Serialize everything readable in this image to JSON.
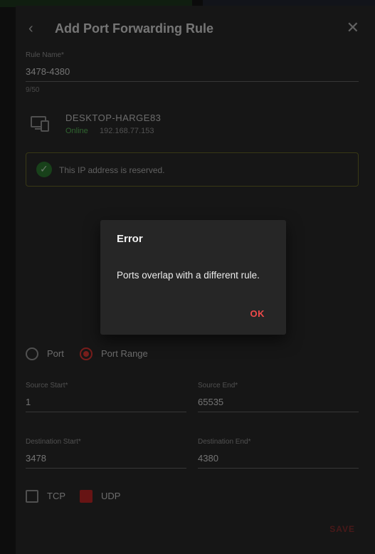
{
  "sheet": {
    "title": "Add Port Forwarding Rule",
    "rule_name": {
      "label": "Rule Name*",
      "value": "3478-4380",
      "helper": "9/50"
    },
    "device": {
      "name": "DESKTOP-HARGE83",
      "status": "Online",
      "ip": "192.168.77.153"
    },
    "reserved_text": "This IP address is reserved.",
    "type_options": [
      {
        "label": "Port",
        "selected": false
      },
      {
        "label": "Port Range",
        "selected": true
      }
    ],
    "source_start": {
      "label": "Source Start*",
      "value": "1"
    },
    "source_end": {
      "label": "Source End*",
      "value": "65535"
    },
    "dest_start": {
      "label": "Destination Start*",
      "value": "3478"
    },
    "dest_end": {
      "label": "Destination End*",
      "value": "4380"
    },
    "protocols": [
      {
        "label": "TCP",
        "checked": false
      },
      {
        "label": "UDP",
        "checked": true
      }
    ],
    "save_label": "SAVE"
  },
  "dialog": {
    "title": "Error",
    "message": "Ports overlap with a different rule.",
    "ok_label": "OK"
  },
  "colors": {
    "accent": "#ef4a4a",
    "sheet_bg": "#2b2b2b",
    "dialog_bg": "#262626",
    "online": "#5bbf5b"
  },
  "icons": {
    "back": "arrow-left-icon",
    "close": "close-icon",
    "device": "computer-icon",
    "check": "check-circle-icon"
  }
}
